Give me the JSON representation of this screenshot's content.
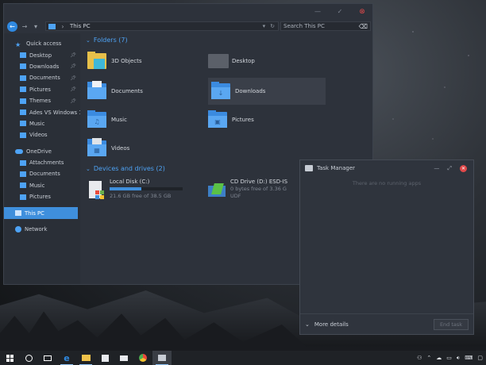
{
  "explorer": {
    "address": "This PC",
    "search_placeholder": "Search This PC",
    "sidebar": {
      "quick_access": "Quick access",
      "quick_items": [
        {
          "label": "Desktop",
          "pinned": true
        },
        {
          "label": "Downloads",
          "pinned": true
        },
        {
          "label": "Documents",
          "pinned": true
        },
        {
          "label": "Pictures",
          "pinned": true
        },
        {
          "label": "Themes",
          "pinned": true
        },
        {
          "label": "Ades VS Windows 1",
          "pinned": false
        },
        {
          "label": "Music",
          "pinned": false
        },
        {
          "label": "Videos",
          "pinned": false
        }
      ],
      "onedrive": "OneDrive",
      "onedrive_items": [
        "Attachments",
        "Documents",
        "Music",
        "Pictures"
      ],
      "this_pc": "This PC",
      "network": "Network"
    },
    "folders_header": "Folders (7)",
    "folders": [
      "3D Objects",
      "Desktop",
      "Documents",
      "Downloads",
      "Music",
      "Pictures",
      "Videos"
    ],
    "drives_header": "Devices and drives (2)",
    "drives": [
      {
        "name": "Local Disk (C:)",
        "free": "21.6 GB free of 38.5 GB",
        "used_fraction": 0.44
      },
      {
        "name": "CD Drive (D:) ESD-IS",
        "free": "0 bytes free of 3.36 G",
        "fs": "UDF"
      }
    ]
  },
  "task_manager": {
    "title": "Task Manager",
    "empty_text": "There are no running apps",
    "more_details": "More details",
    "end_task": "End task"
  },
  "colors": {
    "accent": "#3f8fdc",
    "close": "#e0494a"
  }
}
